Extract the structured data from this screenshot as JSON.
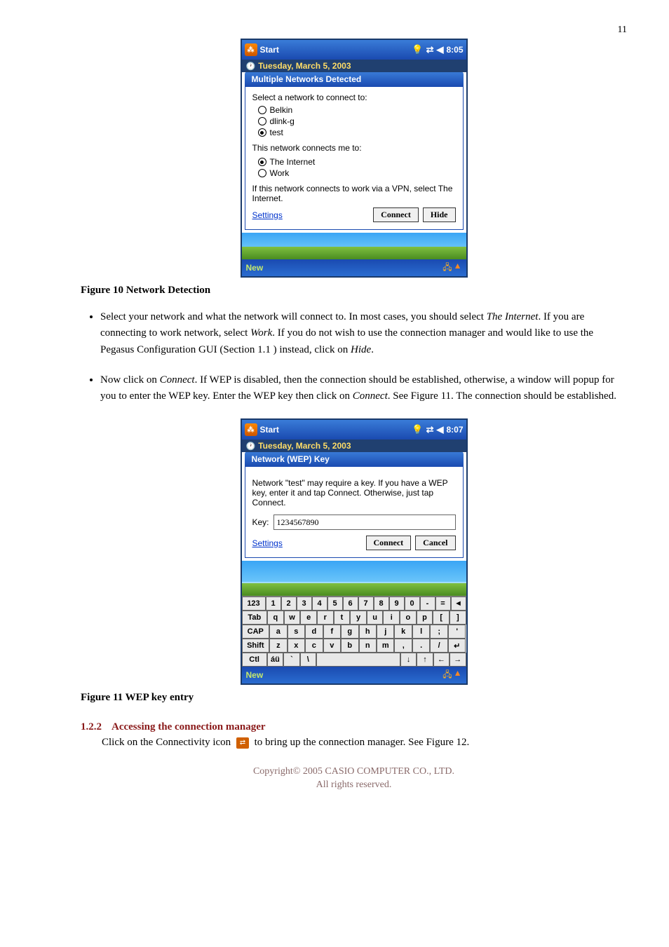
{
  "page_number": "11",
  "shot1": {
    "titlebar": {
      "title": "Start",
      "time": "8:05"
    },
    "date": "Tuesday, March 5, 2003",
    "popup_title": "Multiple Networks Detected",
    "select_prompt": "Select a network to connect to:",
    "nets": [
      {
        "label": "Belkin",
        "selected": false
      },
      {
        "label": "dlink-g",
        "selected": false
      },
      {
        "label": "test",
        "selected": true
      }
    ],
    "connects_prompt": "This network connects me to:",
    "dests": [
      {
        "label": "The Internet",
        "selected": true
      },
      {
        "label": "Work",
        "selected": false
      }
    ],
    "vpn_note": "If this network connects to work via a VPN, select The Internet.",
    "settings": "Settings",
    "connect": "Connect",
    "hide": "Hide",
    "new": "New"
  },
  "caption1": "Figure 10 Network Detection",
  "bullets1": {
    "a_pre": "Select your network and what the network will connect to. In most cases, you should select ",
    "a_i1": "The Internet",
    "a_mid": ". If you are connecting to work network, select ",
    "a_i2": "Work",
    "a_mid2": ". If you do not wish to use the connection manager and would like to use the Pegasus Configuration GUI (Section 1.1   ) instead, click on ",
    "a_i3": "Hide",
    "a_post": ".",
    "b_pre": "Now click on ",
    "b_i1": "Connect",
    "b_mid": ". If WEP is disabled, then the connection should be established, otherwise, a window will popup for you to enter the WEP key. Enter the WEP key then click on ",
    "b_i2": "Connect",
    "b_post": ". See Figure 11. The connection should be established."
  },
  "shot2": {
    "titlebar": {
      "title": "Start",
      "time": "8:07"
    },
    "date": "Tuesday, March 5, 2003",
    "popup_title": "Network (WEP) Key",
    "wep_note": "Network \"test\" may require a key. If you have a WEP key, enter it and tap Connect. Otherwise, just tap Connect.",
    "key_label": "Key:",
    "key_value": "1234567890",
    "settings": "Settings",
    "connect": "Connect",
    "cancel": "Cancel",
    "new": "New",
    "sip": {
      "r1": [
        "123",
        "1",
        "2",
        "3",
        "4",
        "5",
        "6",
        "7",
        "8",
        "9",
        "0",
        "-",
        "=",
        "◄"
      ],
      "r2": [
        "Tab",
        "q",
        "w",
        "e",
        "r",
        "t",
        "y",
        "u",
        "i",
        "o",
        "p",
        "[",
        "]"
      ],
      "r3": [
        "CAP",
        "a",
        "s",
        "d",
        "f",
        "g",
        "h",
        "j",
        "k",
        "l",
        ";",
        "'"
      ],
      "r4": [
        "Shift",
        "z",
        "x",
        "c",
        "v",
        "b",
        "n",
        "m",
        ",",
        ".",
        "/",
        "↵"
      ],
      "r5": [
        "Ctl",
        "áü",
        "`",
        "\\",
        " ",
        "↓",
        "↑",
        "←",
        "→"
      ]
    }
  },
  "caption2": "Figure 11 WEP key entry",
  "section": {
    "num": "1.2.2",
    "title": "Accessing the connection manager",
    "body_pre": "Click on the Connectivity icon ",
    "body_post": " to bring up the connection manager.    See Figure 12."
  },
  "footer": {
    "l1": "Copyright© 2005 CASIO COMPUTER CO., LTD.",
    "l2": "All rights reserved."
  }
}
